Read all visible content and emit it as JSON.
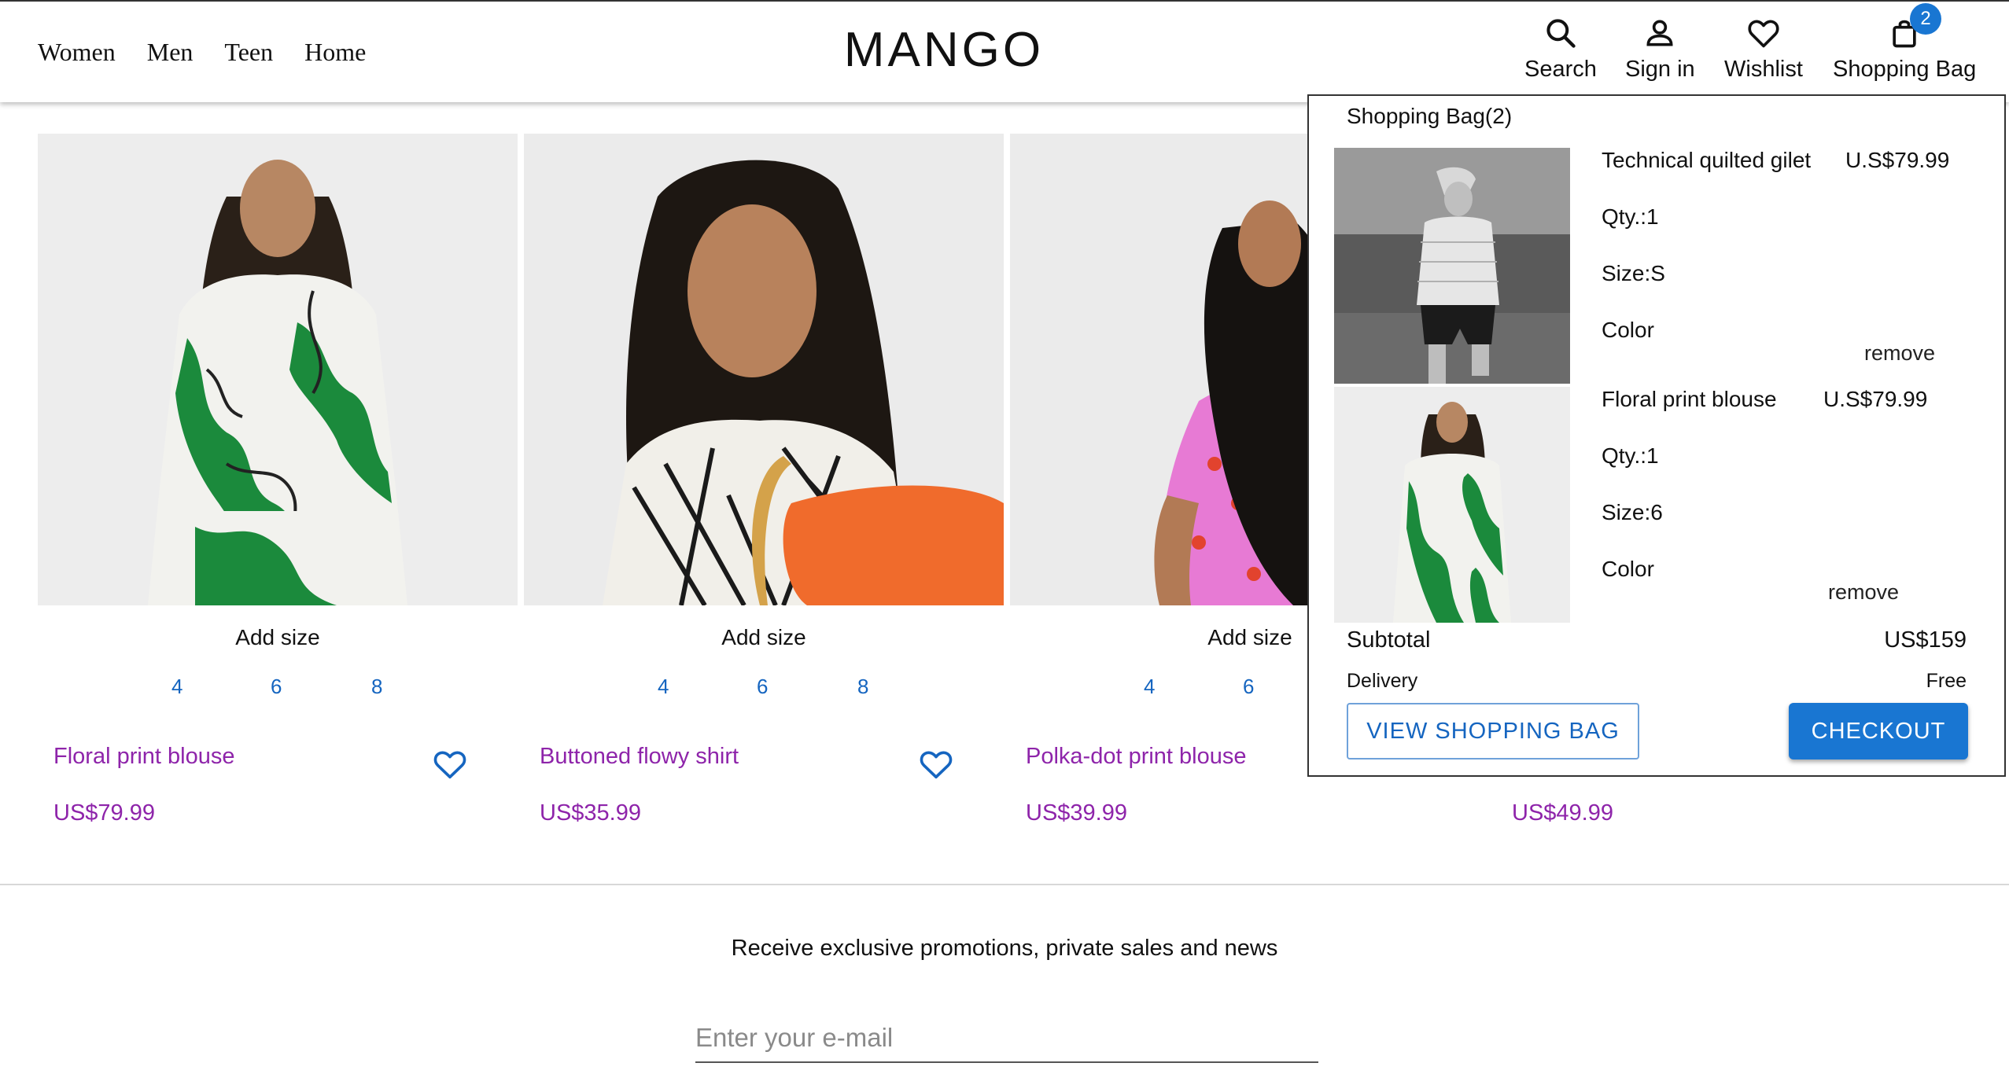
{
  "brand": "MANGO",
  "nav": {
    "women": "Women",
    "men": "Men",
    "teen": "Teen",
    "home": "Home"
  },
  "header_actions": {
    "search": "Search",
    "sign_in": "Sign in",
    "wishlist": "Wishlist",
    "bag": "Shopping Bag",
    "bag_count": "2"
  },
  "products": [
    {
      "name": "Floral print blouse",
      "price": "US$79.99",
      "add_size": "Add size",
      "sizes": [
        "4",
        "6",
        "8"
      ]
    },
    {
      "name": "Buttoned flowy shirt",
      "price": "US$35.99",
      "add_size": "Add size",
      "sizes": [
        "4",
        "6",
        "8"
      ]
    },
    {
      "name": "Polka-dot print blouse",
      "price": "US$39.99",
      "add_size": "Add size",
      "sizes": [
        "4",
        "6"
      ]
    },
    {
      "price": "US$49.99"
    }
  ],
  "bag": {
    "title": "Shopping Bag(2)",
    "items": [
      {
        "name": "Technical quilted gilet",
        "price": "U.S$79.99",
        "qty": "Qty.:1",
        "size": "Size:S",
        "color": "Color",
        "remove": "remove"
      },
      {
        "name": "Floral print blouse",
        "price": "U.S$79.99",
        "qty": "Qty.:1",
        "size": "Size:6",
        "color": "Color",
        "remove": "remove"
      }
    ],
    "subtotal_label": "Subtotal",
    "subtotal_value": "US$159",
    "delivery_label": "Delivery",
    "delivery_value": "Free",
    "view_bag": "VIEW SHOPPING BAG",
    "checkout": "CHECKOUT"
  },
  "footer": {
    "promo": "Receive exclusive promotions, private sales and news",
    "email_placeholder": "Enter your e-mail"
  },
  "colors": {
    "accent": "#1976d2",
    "product_text": "#8e24aa",
    "size_link": "#1565c0"
  }
}
